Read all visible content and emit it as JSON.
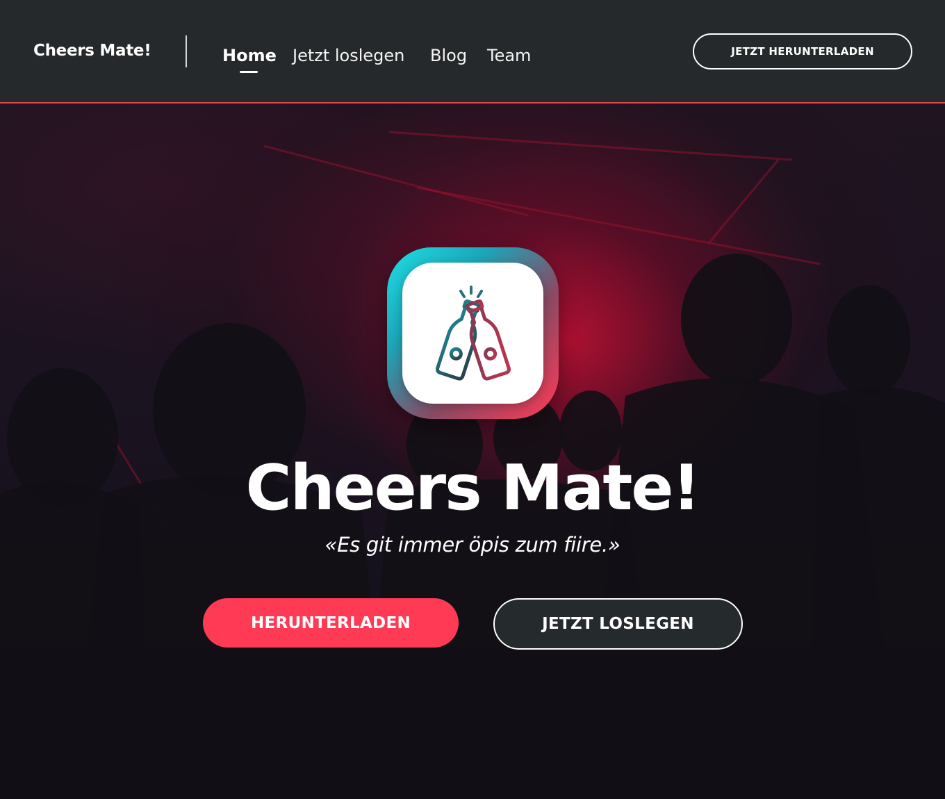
{
  "brand": {
    "name": "Cheers Mate!"
  },
  "nav": {
    "items": [
      {
        "label": "Home",
        "active": true
      },
      {
        "label": "Jetzt loslegen",
        "active": false
      },
      {
        "label": "Blog",
        "active": false
      },
      {
        "label": "Team",
        "active": false
      }
    ]
  },
  "header": {
    "download_label": "JETZT HERUNTERLADEN"
  },
  "hero": {
    "icon": "cheers-bottles-icon",
    "title": "Cheers Mate!",
    "tagline": "«Es git immer öpis zum fiire.»",
    "primary_button": "HERUNTERLADEN",
    "secondary_button": "JETZT LOSLEGEN"
  },
  "colors": {
    "header_bg": "#25292b",
    "accent": "#fe3a55",
    "header_border": "#e2444f",
    "icon_gradient_start": "#1fdfe4",
    "icon_gradient_end": "#ff3a56"
  }
}
